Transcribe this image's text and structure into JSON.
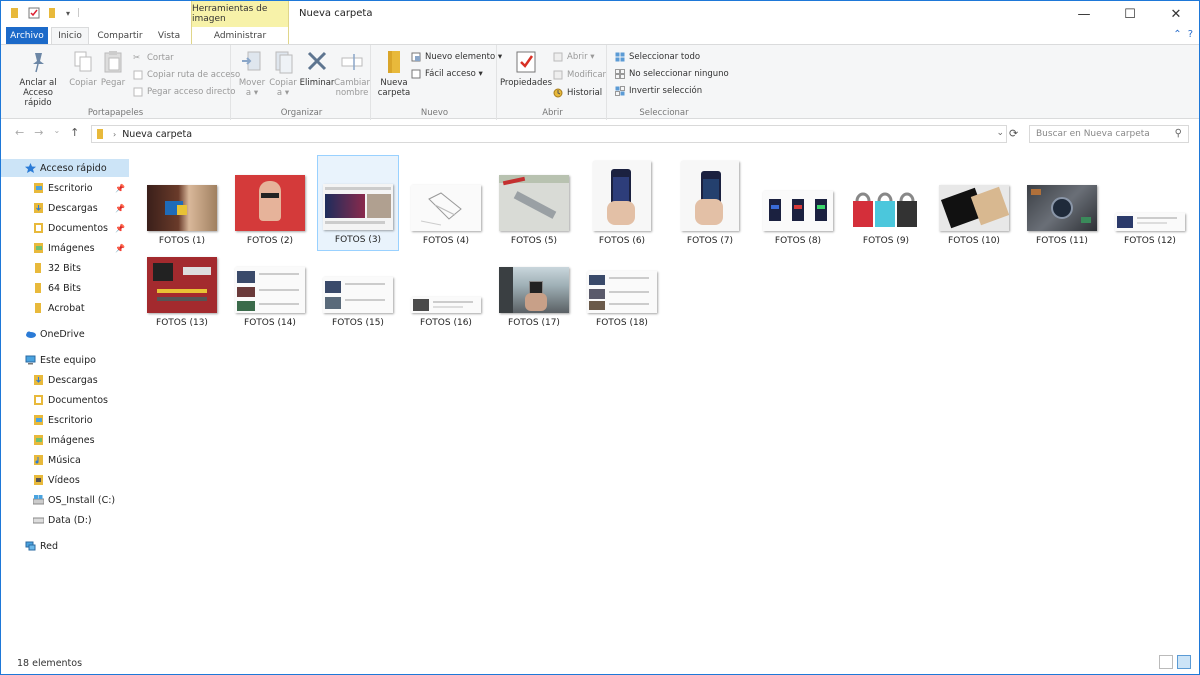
{
  "titlebar": {
    "context_tab": "Herramientas de imagen",
    "title": "Nueva carpeta",
    "minimize": "—",
    "maximize": "☐",
    "close": "✕"
  },
  "tabs": {
    "file": "Archivo",
    "home": "Inicio",
    "share": "Compartir",
    "view": "Vista",
    "manage": "Administrar"
  },
  "ribbon": {
    "clipboard": {
      "pin": "Anclar al Acceso rápido",
      "copy": "Copiar",
      "paste": "Pegar",
      "cut": "Cortar",
      "copy_path": "Copiar ruta de acceso",
      "paste_shortcut": "Pegar acceso directo",
      "label": "Portapapeles"
    },
    "organize": {
      "move": "Mover a ▾",
      "copy_to": "Copiar a ▾",
      "delete": "Eliminar",
      "rename": "Cambiar nombre",
      "label": "Organizar"
    },
    "new": {
      "new_folder": "Nueva carpeta",
      "new_item": "Nuevo elemento ▾",
      "easy_access": "Fácil acceso ▾",
      "label": "Nuevo"
    },
    "open": {
      "properties": "Propiedades",
      "open": "Abrir ▾",
      "edit": "Modificar",
      "history": "Historial",
      "label": "Abrir"
    },
    "select": {
      "select_all": "Seleccionar todo",
      "select_none": "No seleccionar ninguno",
      "invert": "Invertir selección",
      "label": "Seleccionar"
    }
  },
  "address": {
    "path": "Nueva carpeta",
    "search_placeholder": "Buscar en Nueva carpeta"
  },
  "navpane": {
    "items": [
      {
        "label": "Acceso rápido",
        "icon": "star-icon"
      },
      {
        "label": "Escritorio",
        "icon": "desktop-folder-icon"
      },
      {
        "label": "Descargas",
        "icon": "downloads-folder-icon"
      },
      {
        "label": "Documentos",
        "icon": "documents-folder-icon"
      },
      {
        "label": "Imágenes",
        "icon": "pictures-folder-icon"
      },
      {
        "label": "32 Bits",
        "icon": "folder-icon"
      },
      {
        "label": "64 Bits",
        "icon": "folder-icon"
      },
      {
        "label": "Acrobat",
        "icon": "folder-icon"
      },
      {
        "label": "OneDrive",
        "icon": "cloud-icon"
      },
      {
        "label": "Este equipo",
        "icon": "computer-icon"
      },
      {
        "label": "Descargas",
        "icon": "downloads-folder-icon"
      },
      {
        "label": "Documentos",
        "icon": "documents-folder-icon"
      },
      {
        "label": "Escritorio",
        "icon": "desktop-folder-icon"
      },
      {
        "label": "Imágenes",
        "icon": "pictures-folder-icon"
      },
      {
        "label": "Música",
        "icon": "music-folder-icon"
      },
      {
        "label": "Vídeos",
        "icon": "videos-folder-icon"
      },
      {
        "label": "OS_Install (C:)",
        "icon": "drive-icon"
      },
      {
        "label": "Data (D:)",
        "icon": "drive-icon"
      },
      {
        "label": "Red",
        "icon": "network-icon"
      }
    ]
  },
  "files": [
    {
      "name": "FOTOS (1)"
    },
    {
      "name": "FOTOS (2)"
    },
    {
      "name": "FOTOS (3)"
    },
    {
      "name": "FOTOS (4)"
    },
    {
      "name": "FOTOS (5)"
    },
    {
      "name": "FOTOS (6)"
    },
    {
      "name": "FOTOS (7)"
    },
    {
      "name": "FOTOS (8)"
    },
    {
      "name": "FOTOS (9)"
    },
    {
      "name": "FOTOS (10)"
    },
    {
      "name": "FOTOS (11)"
    },
    {
      "name": "FOTOS (12)"
    },
    {
      "name": "FOTOS (13)"
    },
    {
      "name": "FOTOS (14)"
    },
    {
      "name": "FOTOS (15)"
    },
    {
      "name": "FOTOS (16)"
    },
    {
      "name": "FOTOS (17)"
    },
    {
      "name": "FOTOS (18)"
    }
  ],
  "status": {
    "count": "18 elementos"
  },
  "colors": {
    "file_tab": "#1c6ac9",
    "context_tab": "#f7f2a9",
    "selection": "#cce4f7"
  }
}
